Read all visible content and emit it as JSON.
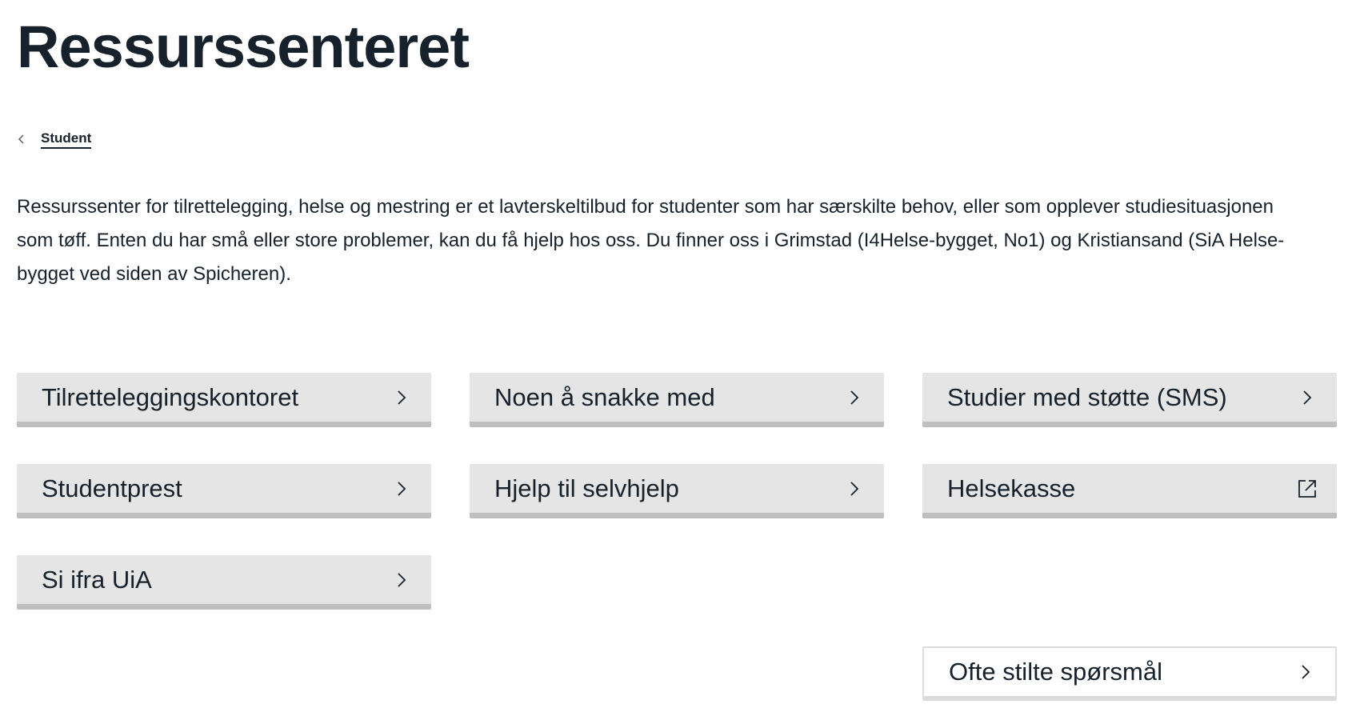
{
  "page": {
    "title": "Ressurssenteret"
  },
  "breadcrumb": {
    "label": "Student"
  },
  "intro": {
    "text": "Ressurssenter for tilrettelegging, helse og mestring er et lavterskeltilbud for studenter som har særskilte behov, eller som opplever studiesituasjonen som tøff. Enten du har små eller store problemer, kan du få hjelp hos oss. Du finner oss i Grimstad (I4Helse-bygget, No1) og Kristiansand (SiA Helse-bygget ved siden av Spicheren)."
  },
  "links": [
    {
      "label": "Tilretteleggingskontoret",
      "icon": "chevron-right-icon"
    },
    {
      "label": "Noen å snakke med",
      "icon": "chevron-right-icon"
    },
    {
      "label": "Studier med støtte (SMS)",
      "icon": "chevron-right-icon"
    },
    {
      "label": "Studentprest",
      "icon": "chevron-right-icon"
    },
    {
      "label": "Hjelp til selvhjelp",
      "icon": "chevron-right-icon"
    },
    {
      "label": "Helsekasse",
      "icon": "external-link-icon"
    },
    {
      "label": "Si ifra UiA",
      "icon": "chevron-right-icon"
    }
  ],
  "faq": {
    "label": "Ofte stilte spørsmål",
    "icon": "chevron-right-icon"
  },
  "colors": {
    "text": "#17212b",
    "tile_bg": "#e5e5e5",
    "tile_border": "#bfbfbf",
    "outline_border": "#dcdcdc"
  }
}
